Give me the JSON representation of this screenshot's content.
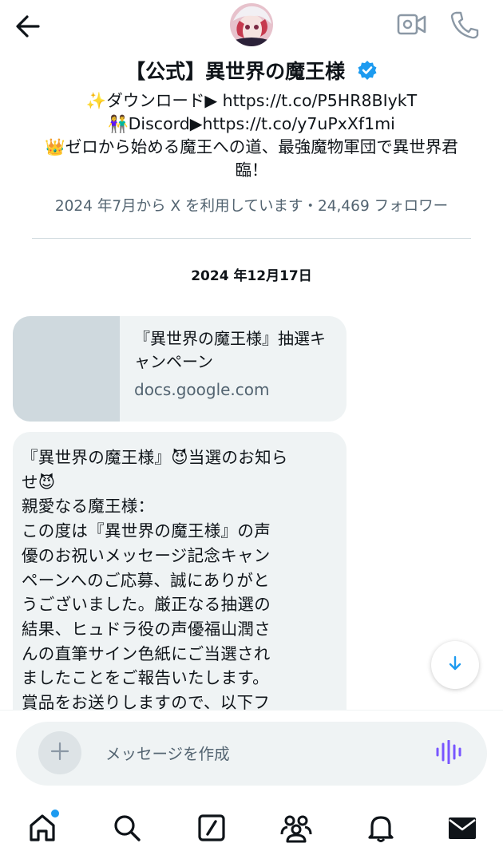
{
  "header": {
    "back_icon": "arrow-left-icon",
    "video_icon": "video-call-icon",
    "phone_icon": "phone-icon"
  },
  "profile": {
    "name": "【公式】異世界の魔王様",
    "verified_icon": "verified-badge-icon",
    "verified_color": "#1d9bf0",
    "bio_line1": "✨ダウンロード▶ https://t.co/P5HR8BIykT",
    "bio_line2": "👫Discord▶https://t.co/y7uPxXf1mi",
    "bio_line3": "👑ゼロから始める魔王への道、最強魔物軍団で異世界君臨！",
    "meta": "2024 年7月から X を利用しています・24,469 フォロワー"
  },
  "conversation": {
    "date": "2024 年12月17日",
    "link_card": {
      "title": "『異世界の魔王様』抽選キャンペーン",
      "domain": "docs.google.com"
    },
    "message_lines": [
      "『異世界の魔王様』😈当選のお知ら",
      "せ😈",
      "親愛なる魔王様：",
      "この度は『異世界の魔王様』の声",
      "優のお祝いメッセージ記念キャン",
      "ペーンへのご応募、誠にありがと",
      "うございました。厳正なる抽選の",
      "結果、ヒュドラ役の声優福山潤さ",
      "んの直筆サイン色紙にご当選され",
      "ましたことをご報告いたします。",
      "賞品をお送りしますので、以下フ"
    ],
    "scroll_icon": "arrow-down-icon"
  },
  "composer": {
    "add_icon": "plus-icon",
    "placeholder": "メッセージを作成",
    "voice_icon": "voice-waveform-icon",
    "voice_color": "#7856ff"
  },
  "bottom_nav": {
    "home_icon": "home-icon",
    "search_icon": "search-icon",
    "grok_icon": "grok-icon",
    "communities_icon": "communities-icon",
    "notifications_icon": "bell-icon",
    "messages_icon": "envelope-icon",
    "badge_color": "#1d9bf0"
  }
}
